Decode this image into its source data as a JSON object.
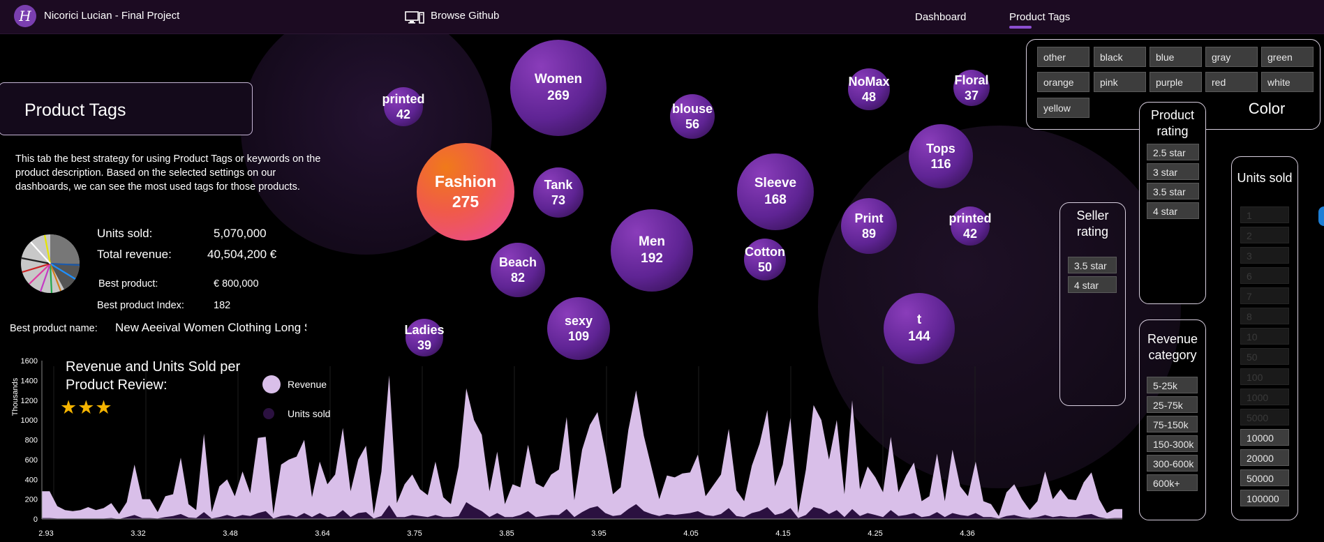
{
  "header": {
    "logo_letter": "H",
    "title": "Nicorici Lucian - Final Project",
    "github_icon": "monitor-icon",
    "github_link": "Browse Github",
    "nav": [
      {
        "label": "Dashboard",
        "active": false
      },
      {
        "label": "Product Tags",
        "active": true
      }
    ]
  },
  "page": {
    "title": "Product Tags",
    "description": "This tab the best strategy for using Product Tags or keywords on the product description. Based on the selected settings on our dashboards, we can see the most used tags for those products."
  },
  "kpis": {
    "units_sold_label": "Units sold:",
    "units_sold_value": "5,070,000",
    "revenue_label": "Total revenue:",
    "revenue_value": "40,504,200 €",
    "best_product_label": "Best product:",
    "best_product_value": "€ 800,000",
    "best_index_label": "Best product Index:",
    "best_index_value": "182",
    "best_name_label": "Best product name:",
    "best_name_value": "New Aeeival Women Clothing Long Sleeve"
  },
  "tags": [
    {
      "name": "printed",
      "count": "42"
    },
    {
      "name": "Women",
      "count": "269"
    },
    {
      "name": "blouse",
      "count": "56"
    },
    {
      "name": "NoMax",
      "count": "48"
    },
    {
      "name": "Floral",
      "count": "37"
    },
    {
      "name": "Fashion",
      "count": "275"
    },
    {
      "name": "Tank",
      "count": "73"
    },
    {
      "name": "Sleeve",
      "count": "168"
    },
    {
      "name": "Tops",
      "count": "116"
    },
    {
      "name": "Men",
      "count": "192"
    },
    {
      "name": "Beach",
      "count": "82"
    },
    {
      "name": "Cotton",
      "count": "50"
    },
    {
      "name": "Print",
      "count": "89"
    },
    {
      "name": "printed",
      "count": "42"
    },
    {
      "name": "sexy",
      "count": "109"
    },
    {
      "name": "Ladies",
      "count": "39"
    },
    {
      "name": "t",
      "count": "144"
    }
  ],
  "filters": {
    "color": {
      "title": "Color",
      "options": [
        "other",
        "black",
        "blue",
        "gray",
        "green",
        "orange",
        "pink",
        "purple",
        "red",
        "white",
        "yellow"
      ]
    },
    "product_rating": {
      "title": "Product rating",
      "options": [
        "2.5 star",
        "3 star",
        "3.5 star",
        "4 star"
      ]
    },
    "seller_rating": {
      "title": "Seller rating",
      "options": [
        "3.5 star",
        "4 star"
      ]
    },
    "revenue_category": {
      "title": "Revenue category",
      "options": [
        "5-25k",
        "25-75k",
        "75-150k",
        "150-300k",
        "300-600k",
        "600k+"
      ]
    },
    "units_sold": {
      "title": "Units sold",
      "options": [
        {
          "label": "1",
          "active": false
        },
        {
          "label": "2",
          "active": false
        },
        {
          "label": "3",
          "active": false
        },
        {
          "label": "6",
          "active": false
        },
        {
          "label": "7",
          "active": false
        },
        {
          "label": "8",
          "active": false
        },
        {
          "label": "10",
          "active": false
        },
        {
          "label": "50",
          "active": false
        },
        {
          "label": "100",
          "active": false
        },
        {
          "label": "1000",
          "active": false
        },
        {
          "label": "5000",
          "active": false
        },
        {
          "label": "10000",
          "active": true
        },
        {
          "label": "20000",
          "active": true
        },
        {
          "label": "50000",
          "active": true
        },
        {
          "label": "100000",
          "active": true
        }
      ]
    }
  },
  "colors": {
    "background": "#000000",
    "topbar": "#1c0b22",
    "bubble": "#5f2494",
    "highlight_bubble_start": "#f07a1a",
    "highlight_bubble_end": "#e8479e",
    "revenue_area": "#d9bfe9",
    "units_area": "#2b1140",
    "star": "#f5b400"
  },
  "chart_data": {
    "type": "area",
    "title": "Revenue and Units Sold per Product Review:",
    "stars": "★★★",
    "ylabel": "Thousands",
    "ylim": [
      0,
      1600
    ],
    "yticks": [
      0,
      200,
      400,
      600,
      800,
      1000,
      1200,
      1400,
      1600
    ],
    "x_tick_labels": [
      "2.93",
      "3.32",
      "3.48",
      "3.64",
      "3.75",
      "3.85",
      "3.95",
      "4.05",
      "4.15",
      "4.25",
      "4.36"
    ],
    "legend": [
      "Revenue",
      "Units sold"
    ],
    "series": [
      {
        "name": "Revenue",
        "values": [
          280,
          280,
          130,
          90,
          80,
          90,
          120,
          90,
          110,
          160,
          50,
          170,
          550,
          200,
          200,
          70,
          230,
          250,
          620,
          150,
          90,
          860,
          70,
          330,
          400,
          230,
          480,
          260,
          820,
          830,
          50,
          550,
          600,
          630,
          800,
          220,
          580,
          350,
          450,
          920,
          280,
          600,
          740,
          50,
          480,
          1450,
          160,
          350,
          450,
          300,
          240,
          580,
          220,
          150,
          530,
          1320,
          1000,
          850,
          280,
          680,
          150,
          350,
          320,
          750,
          360,
          320,
          450,
          500,
          1030,
          190,
          700,
          950,
          1080,
          680,
          250,
          320,
          900,
          1300,
          840,
          520,
          200,
          440,
          420,
          460,
          470,
          650,
          230,
          340,
          450,
          910,
          290,
          180,
          540,
          760,
          1100,
          330,
          550,
          1020,
          60,
          500,
          1150,
          1000,
          600,
          1000,
          250,
          1200,
          300,
          530,
          420,
          270,
          830,
          270,
          440,
          570,
          180,
          230,
          660,
          180,
          700,
          330,
          230,
          580,
          180,
          150,
          30,
          270,
          350,
          200,
          90,
          180,
          480,
          200,
          300,
          200,
          190,
          370,
          470,
          200,
          60,
          100,
          100
        ]
      },
      {
        "name": "Units sold",
        "values": [
          10,
          10,
          5,
          5,
          5,
          5,
          5,
          5,
          5,
          10,
          0,
          20,
          40,
          10,
          10,
          5,
          20,
          30,
          50,
          15,
          10,
          70,
          5,
          20,
          40,
          20,
          40,
          30,
          60,
          80,
          5,
          30,
          40,
          20,
          60,
          20,
          60,
          20,
          30,
          90,
          20,
          60,
          70,
          5,
          30,
          140,
          20,
          20,
          40,
          30,
          20,
          40,
          20,
          20,
          30,
          170,
          120,
          80,
          20,
          60,
          20,
          20,
          40,
          80,
          20,
          30,
          40,
          40,
          100,
          20,
          70,
          110,
          130,
          60,
          30,
          40,
          100,
          150,
          80,
          50,
          30,
          50,
          40,
          50,
          60,
          80,
          40,
          30,
          50,
          110,
          30,
          20,
          60,
          80,
          120,
          40,
          60,
          110,
          10,
          40,
          120,
          100,
          50,
          90,
          20,
          100,
          30,
          60,
          40,
          20,
          90,
          30,
          40,
          60,
          20,
          30,
          70,
          20,
          60,
          40,
          30,
          60,
          20,
          20,
          5,
          30,
          40,
          20,
          10,
          20,
          40,
          20,
          30,
          20,
          20,
          40,
          50,
          20,
          5,
          10,
          10
        ]
      }
    ]
  }
}
